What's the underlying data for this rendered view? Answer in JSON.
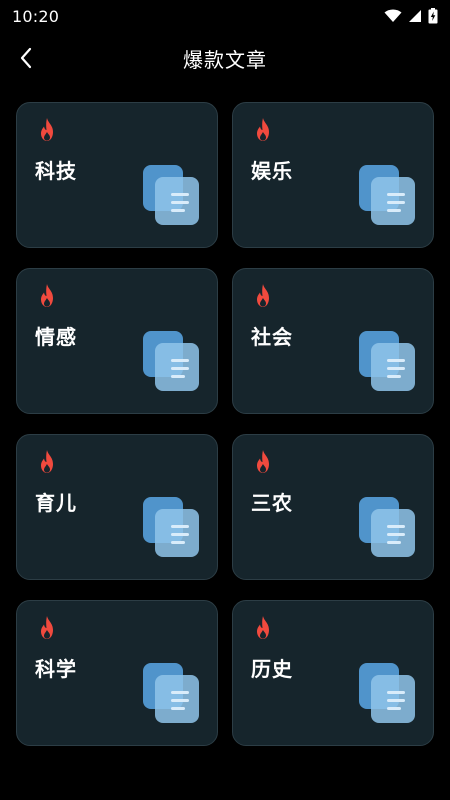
{
  "status_bar": {
    "time": "10:20",
    "icons": [
      "wifi-icon",
      "signal-icon",
      "battery-charging-icon"
    ]
  },
  "header": {
    "title": "爆款文章",
    "back_icon": "chevron-left-icon"
  },
  "categories": [
    {
      "label": "科技"
    },
    {
      "label": "娱乐"
    },
    {
      "label": "情感"
    },
    {
      "label": "社会"
    },
    {
      "label": "育儿"
    },
    {
      "label": "三农"
    },
    {
      "label": "科学"
    },
    {
      "label": "历史"
    }
  ],
  "colors": {
    "background": "#000000",
    "card_bg": "#16252c",
    "card_border": "#2c3d45",
    "fire": "#f04a3e",
    "doc_blue": "#5aa8e8"
  }
}
